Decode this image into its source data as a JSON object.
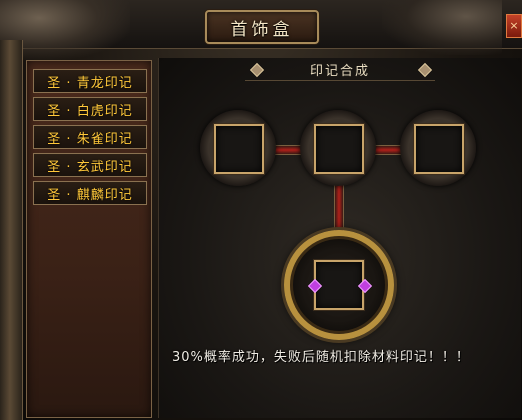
{
  "window": {
    "title": "首饰盒",
    "close_label": "×"
  },
  "list": {
    "items": [
      {
        "label": "圣 · 青龙印记"
      },
      {
        "label": "圣 · 白虎印记"
      },
      {
        "label": "圣 · 朱雀印记"
      },
      {
        "label": "圣 · 玄武印记"
      },
      {
        "label": "圣 · 麒麟印记"
      }
    ]
  },
  "synthesis": {
    "title": "印记合成",
    "hint": "30%概率成功，失败后随机扣除材料印记！！！"
  },
  "colors": {
    "accent_gold": "#c8a46a",
    "item_text": "#ffc83a",
    "connector_red": "#b0201a"
  }
}
